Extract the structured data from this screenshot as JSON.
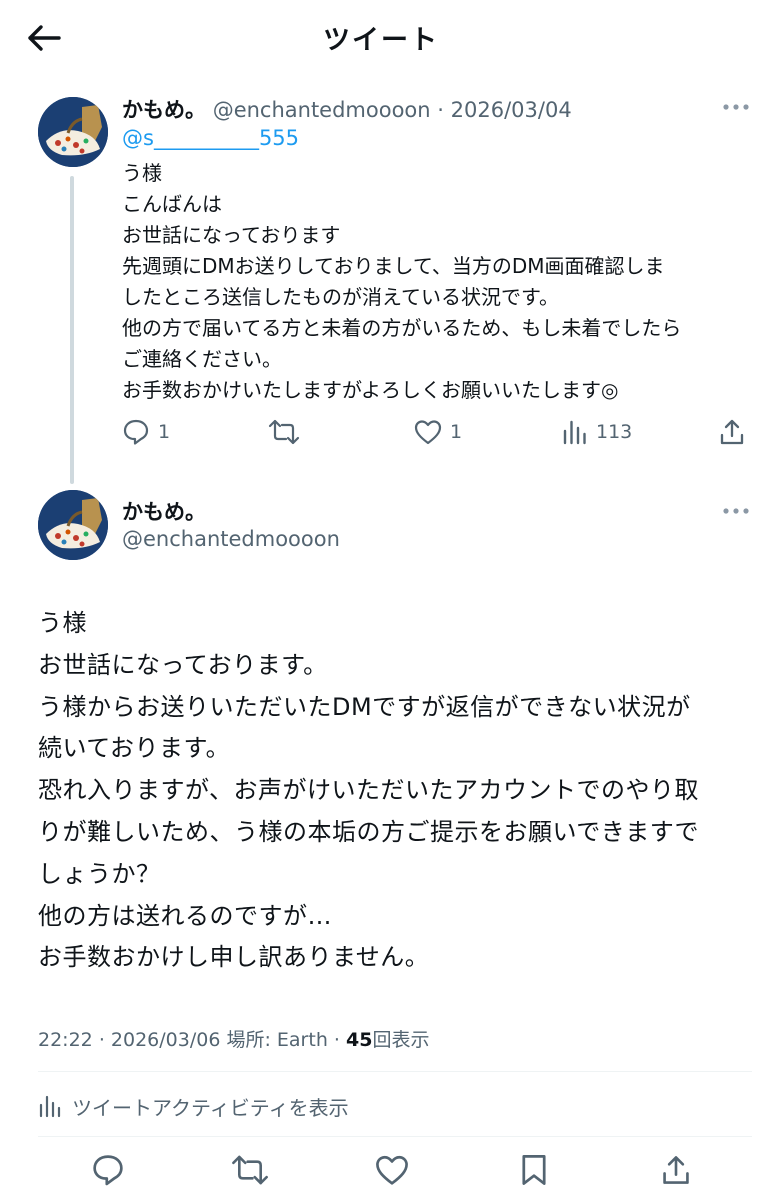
{
  "header": {
    "title": "ツイート"
  },
  "tweet1": {
    "name": "かもめ。",
    "handle": "@enchantedmoooon",
    "separator": "·",
    "date": "2026/03/04",
    "mention": "@s__________555",
    "lines": [
      "う様",
      "こんばんは",
      "お世話になっております",
      "先週頭にDMお送りしておりまして、当方のDM画面確認しま",
      "したところ送信したものが消えている状況です。",
      "他の方で届いてる方と未着の方がいるため、もし未着でしたら",
      "ご連絡ください。",
      "お手数おかけいたしますがよろしくお願いいたします◎"
    ],
    "replies": "1",
    "likes": "1",
    "views": "113"
  },
  "tweet2": {
    "name": "かもめ。",
    "handle": "@enchantedmoooon",
    "lines": [
      "う様",
      "お世話になっております。",
      "う様からお送りいただいたDMですが返信ができない状況が",
      "続いております。",
      "恐れ入りますが、お声がけいただいたアカウントでのやり取",
      "りが難しいため、う様の本垢の方ご提示をお願いできますで",
      "しょうか？",
      "他の方は送れるのですが…",
      "お手数おかけし申し訳ありません。"
    ],
    "time": "22:22",
    "date": "2026/03/06",
    "location": "場所: Earth",
    "views_count": "45",
    "views_label": "回表示",
    "separator": "·"
  },
  "activity": {
    "label": "ツイートアクティビティを表示"
  },
  "icons": {
    "back": "back-arrow-icon",
    "more": "more-dots-icon",
    "reply": "reply-icon",
    "retweet": "retweet-icon",
    "like": "heart-icon",
    "views": "bar-chart-icon",
    "share": "share-icon",
    "bookmark": "bookmark-icon"
  },
  "colors": {
    "text": "#0f1419",
    "muted": "#536471",
    "link": "#1d9bf0",
    "thread_line": "#cfd9de",
    "divider": "#eff3f4",
    "avatar_bg": "#1b3f73"
  }
}
